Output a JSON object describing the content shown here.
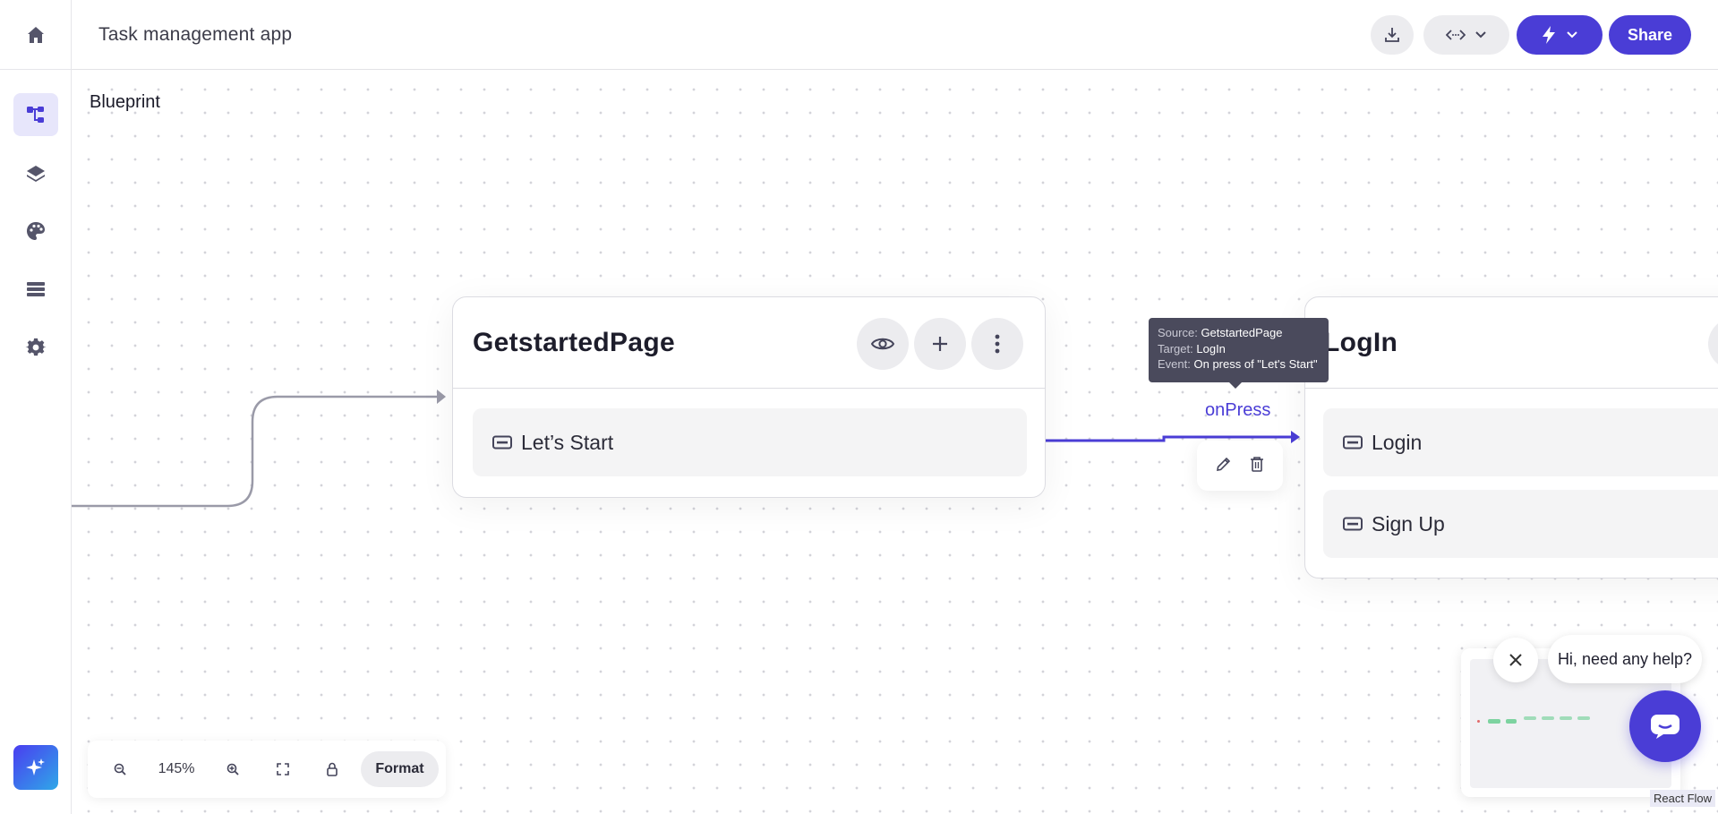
{
  "header": {
    "app_title": "Task management app",
    "share_label": "Share"
  },
  "canvas": {
    "section_label": "Blueprint"
  },
  "nodes": [
    {
      "title": "GetstartedPage",
      "items": [
        "Let’s Start"
      ]
    },
    {
      "title": "LogIn",
      "items": [
        "Login",
        "Sign Up"
      ]
    }
  ],
  "edge": {
    "label": "onPress",
    "tooltip": {
      "source_key": "Source:",
      "source_value": "GetstartedPage",
      "target_key": "Target:",
      "target_value": "LogIn",
      "event_key": "Event:",
      "event_value": "On press of \"Let's Start\""
    }
  },
  "toolbar": {
    "zoom_level": "145%",
    "format_label": "Format"
  },
  "minimap": {
    "attribution": "React Flow"
  },
  "chat": {
    "greeting": "Hi, need any help?"
  },
  "colors": {
    "accent": "#4a3dd6",
    "edge_active": "#4a3dd6",
    "edge_default": "#9a9aa8",
    "minimap_node": "#7dd3a0"
  },
  "icons": {
    "sidebar": [
      "home-icon",
      "blueprint-icon",
      "layers-icon",
      "palette-icon",
      "list-icon",
      "settings-icon",
      "ai-sparkle-icon"
    ],
    "header": [
      "download-icon",
      "code-icon",
      "chevron-down-icon",
      "lightning-icon"
    ],
    "node": [
      "eye-icon",
      "plus-icon",
      "more-vertical-icon",
      "button-icon"
    ],
    "edge": [
      "edit-icon",
      "delete-icon"
    ],
    "toolbar": [
      "zoom-out-icon",
      "zoom-in-icon",
      "fit-view-icon",
      "lock-icon"
    ],
    "chat": [
      "close-icon",
      "chat-icon"
    ]
  }
}
